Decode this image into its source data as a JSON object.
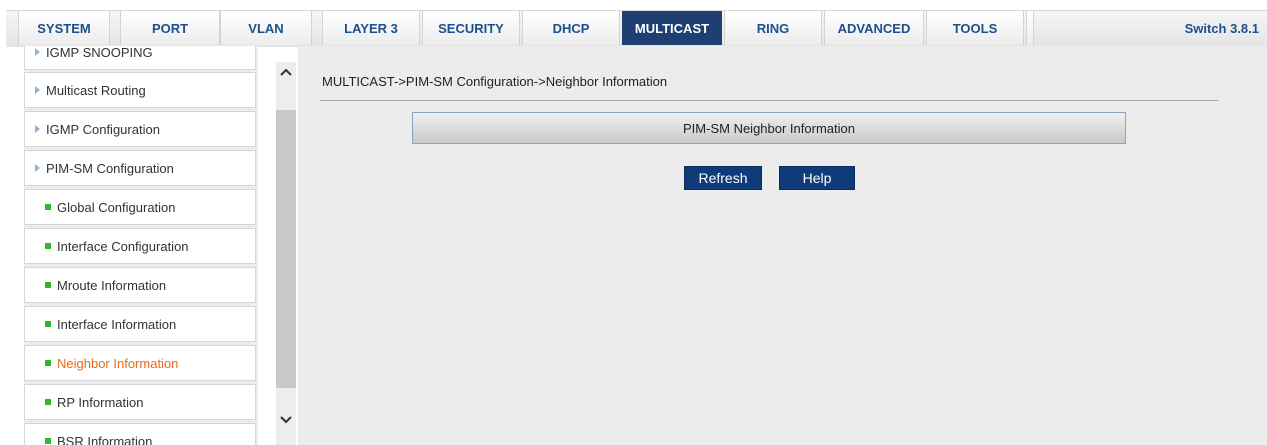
{
  "topnav": {
    "tabs": [
      {
        "label": "SYSTEM"
      },
      {
        "label": "PORT"
      },
      {
        "label": "VLAN"
      },
      {
        "label": "LAYER 3"
      },
      {
        "label": "SECURITY"
      },
      {
        "label": "DHCP"
      },
      {
        "label": "MULTICAST"
      },
      {
        "label": "RING"
      },
      {
        "label": "ADVANCED"
      },
      {
        "label": "TOOLS"
      }
    ],
    "active_tab": "MULTICAST",
    "version": "Switch 3.8.1"
  },
  "sidebar": {
    "items": [
      {
        "label": "IGMP SNOOPING",
        "level": 1
      },
      {
        "label": "Multicast Routing",
        "level": 1
      },
      {
        "label": "IGMP Configuration",
        "level": 1
      },
      {
        "label": "PIM-SM Configuration",
        "level": 1
      },
      {
        "label": "Global Configuration",
        "level": 2
      },
      {
        "label": "Interface Configuration",
        "level": 2
      },
      {
        "label": "Mroute Information",
        "level": 2
      },
      {
        "label": "Interface Information",
        "level": 2
      },
      {
        "label": "Neighbor Information",
        "level": 2
      },
      {
        "label": "RP Information",
        "level": 2
      },
      {
        "label": "BSR Information",
        "level": 2
      }
    ],
    "selected_item": "Neighbor Information"
  },
  "main": {
    "breadcrumb": "MULTICAST->PIM-SM Configuration->Neighbor Information",
    "panel_title": "PIM-SM Neighbor Information",
    "refresh_label": "Refresh",
    "help_label": "Help"
  },
  "colors": {
    "tab_text": "#1d4f8c",
    "active_tab_bg": "#1d3f72",
    "button_bg": "#0f3b78",
    "selected_item_text": "#ee6a1a",
    "bullet": "#2fb52f"
  },
  "icons": {
    "scroll_up": "chevron-up-icon",
    "scroll_down": "chevron-down-icon",
    "expand": "triangle-right-icon",
    "leaf": "square-bullet-icon"
  }
}
